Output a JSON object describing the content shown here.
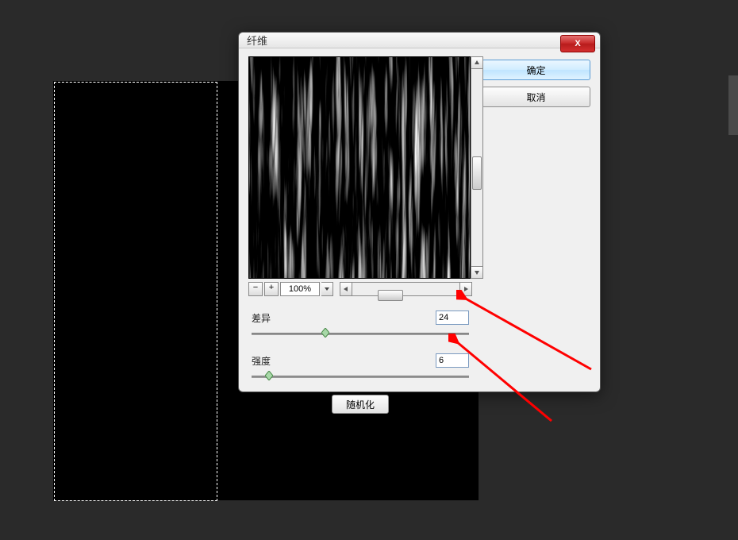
{
  "dialog": {
    "title": "纤维",
    "close_label": "X",
    "ok_label": "确定",
    "cancel_label": "取消",
    "zoom_value": "100%",
    "variance": {
      "label": "差异",
      "value": "24",
      "percent": 34
    },
    "strength": {
      "label": "强度",
      "value": "6",
      "percent": 8
    },
    "randomize_label": "随机化"
  },
  "icons": {
    "minus": "−",
    "plus": "+"
  },
  "colors": {
    "arrow": "#ff0000"
  }
}
